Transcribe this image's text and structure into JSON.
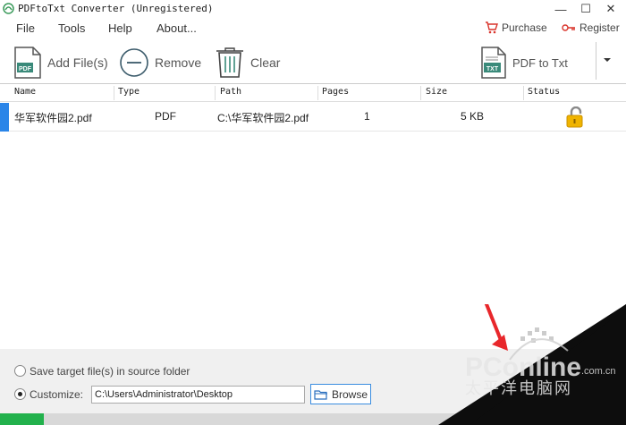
{
  "window": {
    "title": "PDFtoTxt Converter (Unregistered)",
    "minimize_glyph": "—",
    "maximize_glyph": "☐",
    "close_glyph": "✕"
  },
  "menu": {
    "items": [
      "File",
      "Tools",
      "Help",
      "About..."
    ],
    "purchase": "Purchase",
    "register": "Register"
  },
  "toolbar": {
    "add_files": "Add File(s)",
    "remove": "Remove",
    "clear": "Clear",
    "convert": "PDF to Txt",
    "pdf_icon_text": "PDF",
    "txt_icon_text": "TXT"
  },
  "table": {
    "columns": [
      "Name",
      "Type",
      "Path",
      "Pages",
      "Size",
      "Status"
    ],
    "rows": [
      {
        "name": "华军软件园2.pdf",
        "type": "PDF",
        "path": "C:\\华军软件园2.pdf",
        "pages": "1",
        "size": "5 KB",
        "status_icon": "unlocked-icon"
      }
    ]
  },
  "output": {
    "option_source": "Save target file(s) in source folder",
    "option_custom": "Customize:",
    "custom_path": "C:\\Users\\Administrator\\Desktop",
    "browse": "Browse",
    "selected": "custom"
  },
  "progress": {
    "percent": 7
  },
  "watermark": {
    "brand": "PConline",
    "domain": ".com.cn",
    "chinese": "太平洋电脑网"
  },
  "colors": {
    "accent_blue": "#2a85e8",
    "purchase_red": "#d9342b",
    "progress_green": "#22b14c",
    "lock_gold": "#f0b400"
  }
}
